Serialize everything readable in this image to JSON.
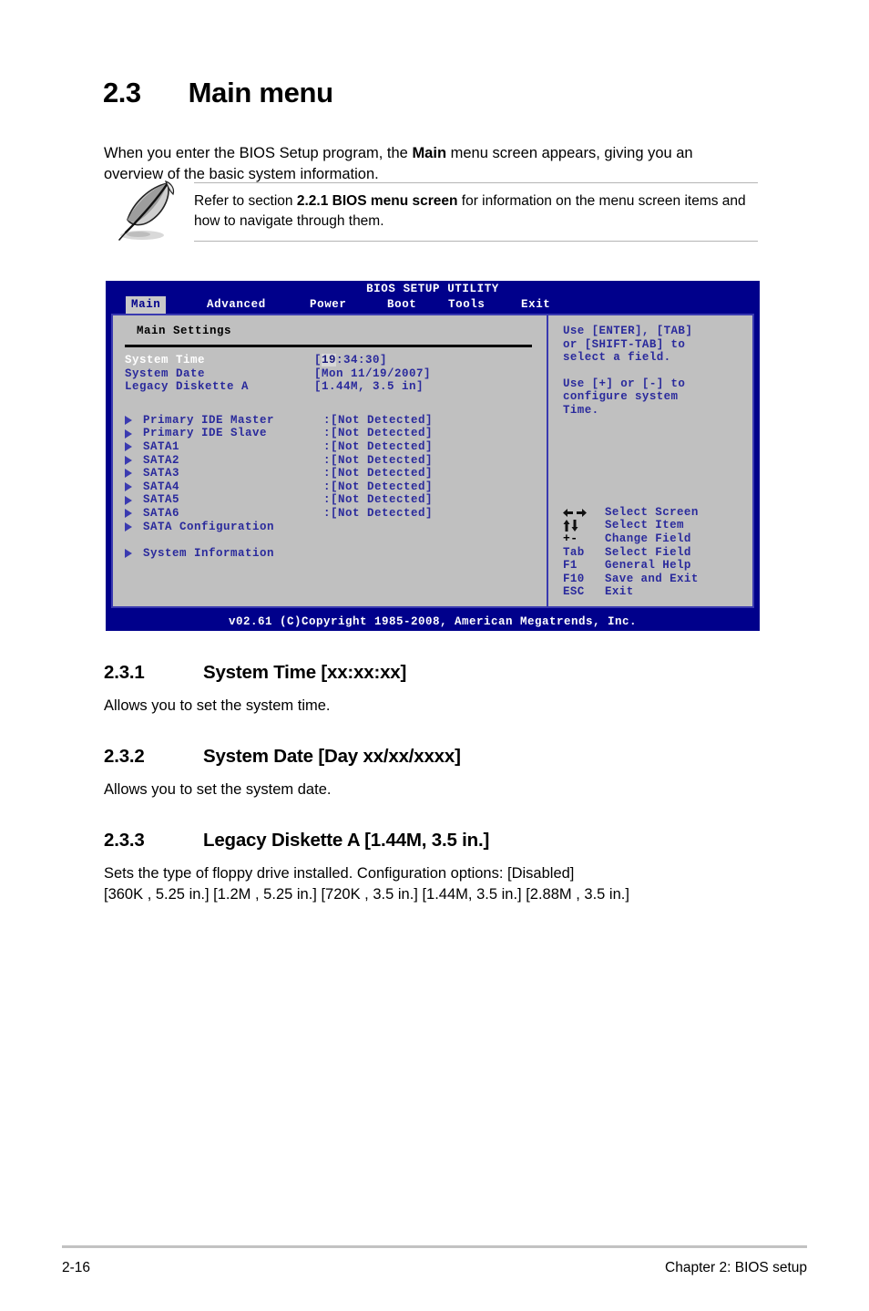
{
  "section": {
    "number": "2.3",
    "title": "Main menu",
    "intro_before": "When you enter the BIOS Setup program, the ",
    "intro_bold": "Main",
    "intro_after": " menu screen appears, giving you an overview of the basic system information."
  },
  "note": {
    "icon": "quill-pen-icon",
    "text_before": "Refer to section ",
    "text_bold": "2.2.1 BIOS menu screen",
    "text_after": " for information on the menu screen items and how to navigate through them."
  },
  "bios": {
    "title": "BIOS SETUP UTILITY",
    "tabs": [
      {
        "label": "Main",
        "active": true
      },
      {
        "label": "Advanced",
        "active": false
      },
      {
        "label": "Power",
        "active": false
      },
      {
        "label": "Boot",
        "active": false
      },
      {
        "label": "Tools",
        "active": false
      },
      {
        "label": "Exit",
        "active": false
      }
    ],
    "panel_title": "Main Settings",
    "fields": [
      {
        "key": "System Time",
        "value_prefix": "[",
        "value_cursor": "19",
        "value_suffix": ":34:30]",
        "selected": true
      },
      {
        "key": "System Date",
        "value": "[Mon 11/19/2007]",
        "selected": false
      },
      {
        "key": "Legacy Diskette A",
        "value": "[1.44M, 3.5 in]",
        "selected": false
      }
    ],
    "drives": [
      {
        "label": "Primary IDE Master",
        "value": ":[Not Detected]"
      },
      {
        "label": "Primary IDE Slave",
        "value": ":[Not Detected]"
      },
      {
        "label": "SATA1",
        "value": ":[Not Detected]"
      },
      {
        "label": "SATA2",
        "value": ":[Not Detected]"
      },
      {
        "label": "SATA3",
        "value": ":[Not Detected]"
      },
      {
        "label": "SATA4",
        "value": ":[Not Detected]"
      },
      {
        "label": "SATA5",
        "value": ":[Not Detected]"
      },
      {
        "label": "SATA6",
        "value": ":[Not Detected]"
      },
      {
        "label": "SATA Configuration",
        "value": ""
      }
    ],
    "extra_items": [
      {
        "label": "System Information",
        "value": ""
      }
    ],
    "help_paragraph_1": "Use [ENTER], [TAB]\nor [SHIFT-TAB] to\nselect a field.",
    "help_paragraph_2": "Use [+] or [-] to\nconfigure system\nTime.",
    "legend": [
      {
        "key_icon": "left-right-arrows-icon",
        "key": "←→",
        "desc": "Select Screen"
      },
      {
        "key_icon": "up-down-arrows-icon",
        "key": "↑↓",
        "desc": "Select Item"
      },
      {
        "key_icon": "plus-minus-icon",
        "key": "+-",
        "desc": "Change Field"
      },
      {
        "key_icon": "tab-key-icon",
        "key": "Tab",
        "desc": "Select Field"
      },
      {
        "key_icon": "f1-key-icon",
        "key": "F1",
        "desc": "General Help"
      },
      {
        "key_icon": "f10-key-icon",
        "key": "F10",
        "desc": "Save and Exit"
      },
      {
        "key_icon": "esc-key-icon",
        "key": "ESC",
        "desc": "Exit"
      }
    ],
    "footer": "v02.61 (C)Copyright 1985-2008, American Megatrends, Inc.",
    "colors": {
      "chrome_blue": "#00008b",
      "panel_gray": "#c0c0c0",
      "label_blue": "#2a2a9c",
      "border_blue": "#3a3ab0",
      "active_tab_bg": "#c8c8c8"
    }
  },
  "subsections": [
    {
      "number": "2.3.1",
      "title": "System Time [xx:xx:xx]",
      "body": "Allows you to set the system time."
    },
    {
      "number": "2.3.2",
      "title": "System Date [Day xx/xx/xxxx]",
      "body": "Allows you to set the system date."
    },
    {
      "number": "2.3.3",
      "title": "Legacy Diskette A [1.44M, 3.5 in.]",
      "body": "Sets the type of floppy drive installed. Configuration options: [Disabled]\n[360K , 5.25 in.] [1.2M , 5.25 in.] [720K , 3.5 in.] [1.44M, 3.5 in.] [2.88M , 3.5 in.]"
    }
  ],
  "page_footer": {
    "page_number": "2-16",
    "chapter": "Chapter 2: BIOS setup"
  }
}
